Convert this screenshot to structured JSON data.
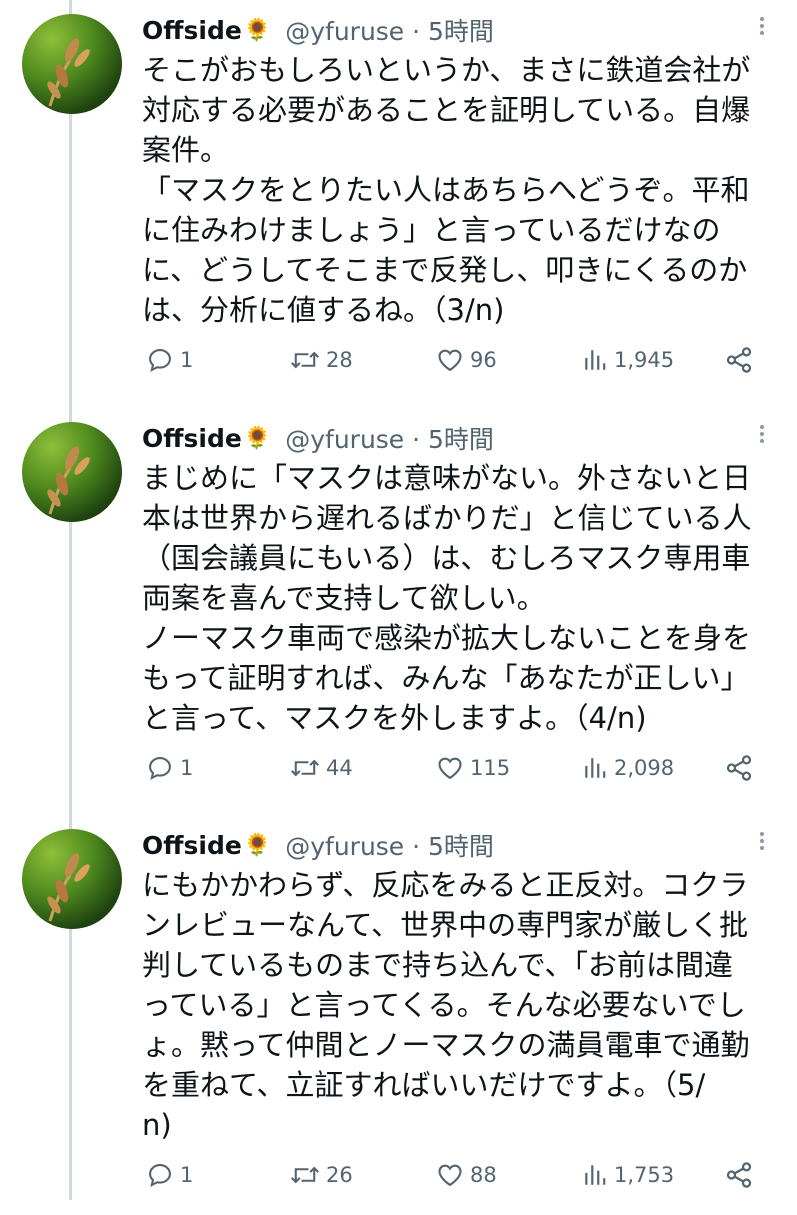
{
  "tweets": [
    {
      "name": "Offside",
      "emoji": "🌻",
      "handle_time": "@yfuruse · 5時間",
      "text": "そこがおもしろいというか、まさに鉄道会社が\n対応する必要があることを証明している。自爆\n案件。\n「マスクをとりたい人はあちらへどうぞ。平和\nに住みわけましょう」と言っているだけなの\nに、どうしてそこまで反発し、叩きにくるのか\nは、分析に値するね。（3/n)",
      "replies": "1",
      "retweets": "28",
      "likes": "96",
      "views": "1,945"
    },
    {
      "name": "Offside",
      "emoji": "🌻",
      "handle_time": "@yfuruse · 5時間",
      "text": "まじめに「マスクは意味がない。外さないと日\n本は世界から遅れるばかりだ」と信じている人\n（国会議員にもいる）は、むしろマスク専用車\n両案を喜んで支持して欲しい。\nノーマスク車両で感染が拡大しないことを身を\nもって証明すれば、みんな「あなたが正しい」\nと言って、マスクを外しますよ。（4/n)",
      "replies": "1",
      "retweets": "44",
      "likes": "115",
      "views": "2,098"
    },
    {
      "name": "Offside",
      "emoji": "🌻",
      "handle_time": "@yfuruse · 5時間",
      "text": "にもかかわらず、反応をみると正反対。コクラ\nンレビューなんて、世界中の専門家が厳しく批\n判しているものまで持ち込んで、「お前は間違\nっている」と言ってくる。そんな必要ないでし\nょ。黙って仲間とノーマスクの満員電車で通勤\nを重ねて、立証すればいいだけですよ。（5/\nn)",
      "replies": "1",
      "retweets": "26",
      "likes": "88",
      "views": "1,753"
    }
  ]
}
